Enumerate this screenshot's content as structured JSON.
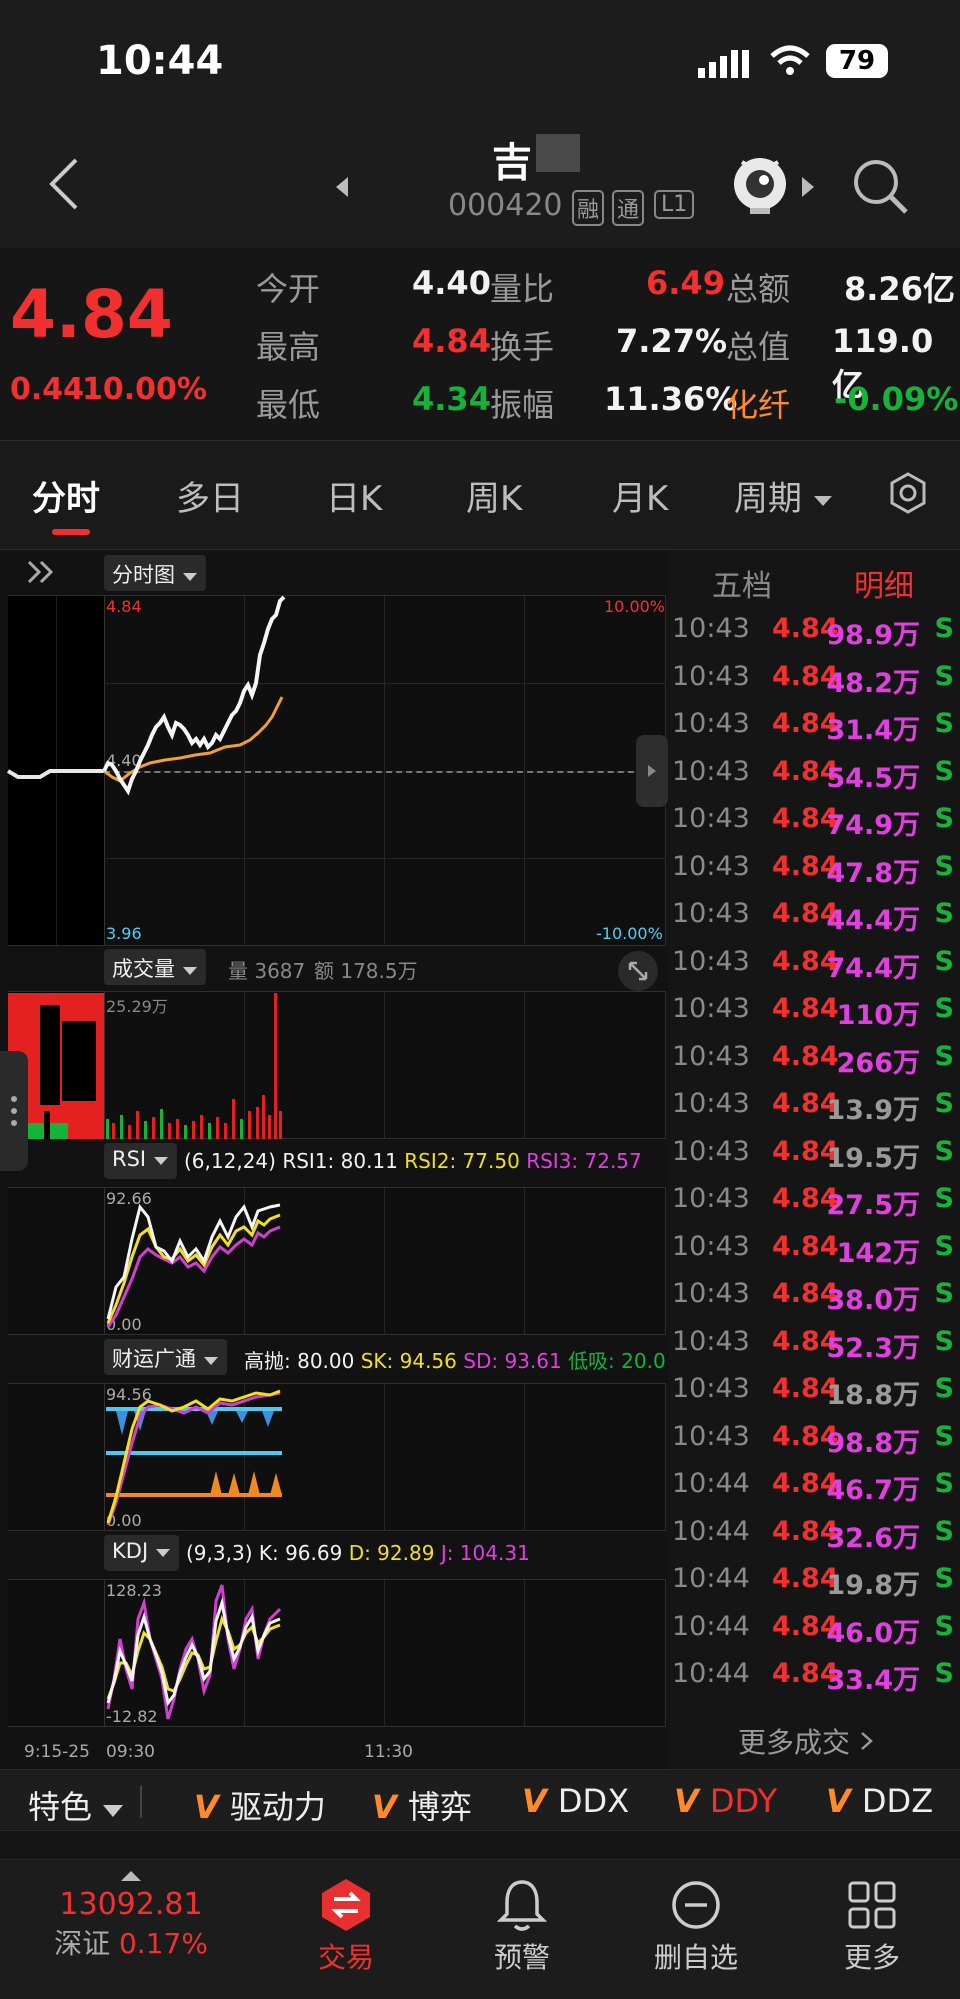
{
  "status": {
    "time": "10:44",
    "battery": "79"
  },
  "header": {
    "title": "吉",
    "code": "000420",
    "badges": [
      "融",
      "通",
      "L1"
    ]
  },
  "quote": {
    "price": "4.84",
    "change": "0.44",
    "change_pct": "10.00%",
    "stats": [
      {
        "l1": "今开",
        "v1": "4.40",
        "l2": "量比",
        "v2": "6.49",
        "l3": "总额",
        "v3": "8.26亿"
      },
      {
        "l1": "最高",
        "v1": "4.84",
        "l2": "换手",
        "v2": "7.27%",
        "l3": "总值",
        "v3": "119.0亿"
      },
      {
        "l1": "最低",
        "v1": "4.34",
        "l2": "振幅",
        "v2": "11.36%",
        "l3": "化纤",
        "v3": "-0.09%"
      }
    ]
  },
  "tabs": [
    "分时",
    "多日",
    "日K",
    "周K",
    "月K",
    "周期"
  ],
  "chart": {
    "main_label": "分时图",
    "high": "4.84",
    "high_pct": "10.00%",
    "open": "4.40",
    "low": "3.96",
    "low_pct": "-10.00%",
    "vol_label": "成交量",
    "vol_info": "量 3687",
    "amt_info": "额 178.5万",
    "vol_max": "25.29万",
    "rsi": {
      "label": "RSI",
      "params": "(6,12,24)",
      "r1": "RSI1: 80.11",
      "r2": "RSI2: 77.50",
      "r3": "RSI3: 72.57",
      "max": "92.66",
      "min": "0.00"
    },
    "cyg": {
      "label": "财运广通",
      "a": "高抛: 80.00",
      "b": "SK: 94.56",
      "c": "SD: 93.61",
      "d": "低吸: 20.0",
      "max": "94.56",
      "min": "0.00"
    },
    "kdj": {
      "label": "KDJ",
      "params": "(9,3,3)",
      "k": "K: 96.69",
      "d": "D: 92.89",
      "j": "J: 104.31",
      "max": "128.23",
      "min": "-12.82"
    },
    "time_labels": [
      "9:15-25",
      "09:30",
      "11:30"
    ]
  },
  "trades_tabs": [
    "五档",
    "明细"
  ],
  "trades": [
    {
      "t": "10:43",
      "p": "4.84",
      "v": "98.9万",
      "c": "m"
    },
    {
      "t": "10:43",
      "p": "4.84",
      "v": "48.2万",
      "c": "m"
    },
    {
      "t": "10:43",
      "p": "4.84",
      "v": "31.4万",
      "c": "m"
    },
    {
      "t": "10:43",
      "p": "4.84",
      "v": "54.5万",
      "c": "m"
    },
    {
      "t": "10:43",
      "p": "4.84",
      "v": "74.9万",
      "c": "m"
    },
    {
      "t": "10:43",
      "p": "4.84",
      "v": "47.8万",
      "c": "m"
    },
    {
      "t": "10:43",
      "p": "4.84",
      "v": "44.4万",
      "c": "m"
    },
    {
      "t": "10:43",
      "p": "4.84",
      "v": "74.4万",
      "c": "m"
    },
    {
      "t": "10:43",
      "p": "4.84",
      "v": "110万",
      "c": "m"
    },
    {
      "t": "10:43",
      "p": "4.84",
      "v": "266万",
      "c": "m"
    },
    {
      "t": "10:43",
      "p": "4.84",
      "v": "13.9万",
      "c": "g"
    },
    {
      "t": "10:43",
      "p": "4.84",
      "v": "19.5万",
      "c": "g"
    },
    {
      "t": "10:43",
      "p": "4.84",
      "v": "27.5万",
      "c": "m"
    },
    {
      "t": "10:43",
      "p": "4.84",
      "v": "142万",
      "c": "m"
    },
    {
      "t": "10:43",
      "p": "4.84",
      "v": "38.0万",
      "c": "m"
    },
    {
      "t": "10:43",
      "p": "4.84",
      "v": "52.3万",
      "c": "m"
    },
    {
      "t": "10:43",
      "p": "4.84",
      "v": "18.8万",
      "c": "g"
    },
    {
      "t": "10:43",
      "p": "4.84",
      "v": "98.8万",
      "c": "m"
    },
    {
      "t": "10:44",
      "p": "4.84",
      "v": "46.7万",
      "c": "m"
    },
    {
      "t": "10:44",
      "p": "4.84",
      "v": "32.6万",
      "c": "m"
    },
    {
      "t": "10:44",
      "p": "4.84",
      "v": "19.8万",
      "c": "g"
    },
    {
      "t": "10:44",
      "p": "4.84",
      "v": "46.0万",
      "c": "m"
    },
    {
      "t": "10:44",
      "p": "4.84",
      "v": "33.4万",
      "c": "m"
    }
  ],
  "trade_side": "S",
  "more_trades": "更多成交",
  "indicators": {
    "special": "特色",
    "items": [
      "驱动力",
      "博弈",
      "DDX",
      "DDY",
      "DDZ"
    ]
  },
  "nav": {
    "index_value": "13092.81",
    "index_name": "深证",
    "index_pct": "0.17%",
    "items": [
      "交易",
      "预警",
      "删自选",
      "更多"
    ]
  }
}
